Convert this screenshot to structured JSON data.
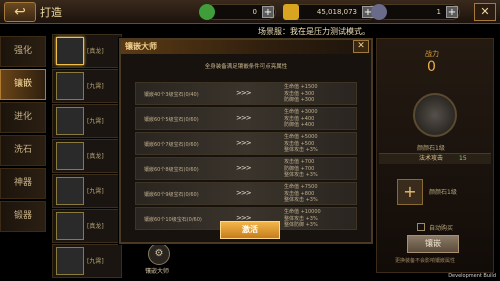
{
  "top": {
    "title": "打造",
    "res1": "0",
    "res2": "45,018,073",
    "res3": "1",
    "plus": "+",
    "close": "✕",
    "colors": {
      "res1": "#3f9e3a",
      "res2": "#d9a520",
      "res3": "#6a6a8a"
    }
  },
  "tabs": [
    "强化",
    "镶嵌",
    "进化",
    "洗石",
    "神器",
    "锻器"
  ],
  "items": [
    {
      "name": "[真龙]"
    },
    {
      "name": "[九霄]"
    },
    {
      "name": "[九霄]"
    },
    {
      "name": "[真龙]"
    },
    {
      "name": "[九霄]"
    },
    {
      "name": "[真龙]"
    },
    {
      "name": "[九霄]"
    }
  ],
  "scene_text": "场景服：我在是压力测试模式。",
  "right": {
    "power_label": "战力",
    "power_value": "0",
    "gem_name": "颜颜石1级",
    "bar_label": "法术攻击",
    "bar_count": "15",
    "gem_name2": "颜颜石1级",
    "auto_label": "自动购买",
    "embed_button": "镶嵌",
    "hint": "更换装备不会影响镶嵌属性"
  },
  "master": {
    "label": "镶嵌大师"
  },
  "dev_label": "Development Build",
  "modal": {
    "title": "镶嵌大师",
    "close": "✕",
    "subtitle": "全身装备满足镶嵌条件可点亮属性",
    "arrow": ">>>",
    "rows": [
      {
        "cond": "镶嵌40个3级宝石(0/40)",
        "attrs": [
          "生命值 +1500",
          "攻击值 +300",
          "防御值 +300"
        ]
      },
      {
        "cond": "镶嵌60个5级宝石(0/60)",
        "attrs": [
          "生命值 +3000",
          "攻击值 +400",
          "防御值 +400"
        ]
      },
      {
        "cond": "镶嵌60个7级宝石(0/60)",
        "attrs": [
          "生命值 +5000",
          "攻击值 +500",
          "整体攻击 +3%"
        ]
      },
      {
        "cond": "镶嵌60个8级宝石(0/60)",
        "attrs": [
          "攻击值 +700",
          "防御值 +700",
          "整体攻击 +3%"
        ]
      },
      {
        "cond": "镶嵌60个9级宝石(0/60)",
        "attrs": [
          "生命值 +7500",
          "攻击值 +800",
          "整体攻击 +3%"
        ]
      },
      {
        "cond": "镶嵌60个10级宝石(0/60)",
        "attrs": [
          "生命值 +10000",
          "整体攻击 +3%",
          "整体防御 +3%"
        ]
      }
    ],
    "activate": "激活"
  }
}
